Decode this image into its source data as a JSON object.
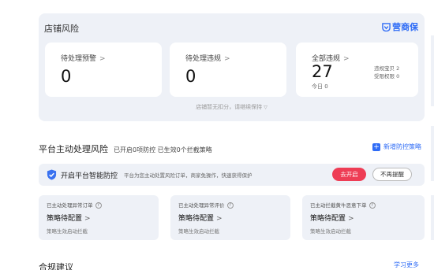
{
  "store_risk": {
    "title": "店铺风险",
    "brand": "营商保",
    "cards": [
      {
        "label": "待处理预警",
        "value": "0"
      },
      {
        "label": "待处理违规",
        "value": "0"
      },
      {
        "label": "全部违规",
        "value": "27",
        "today": "今日 0",
        "side": [
          "违规宝贝 2",
          "受限权限 0"
        ]
      }
    ],
    "note": "店铺暂无扣分，请继续保持"
  },
  "platform": {
    "title": "平台主动处理风险",
    "subtitle": "已开启0项防控 已生效0个拦截策略",
    "add_strategy": "新增防控策略",
    "smart": {
      "title": "开启平台智能防控",
      "desc": "平台为您主动处置风险订单，商家免操作，快速获得保护",
      "open_button": "去开启",
      "dismiss_button": "不再提醒"
    },
    "cards": [
      {
        "label": "已主动处理异常订单",
        "status": "策略待配置",
        "note": "策略生效启动拦截"
      },
      {
        "label": "已主动处理异常评价",
        "status": "策略待配置",
        "note": "策略生效启动拦截"
      },
      {
        "label": "已主动拦截黄牛恶意下单",
        "status": "策略待配置",
        "note": "策略生效启动拦截"
      }
    ]
  },
  "compliance": {
    "title": "合规建议",
    "learn_more": "学习更多"
  },
  "icons": {
    "chevron": "chevron-right-icon",
    "help": "help-circle-icon",
    "shield": "shield-icon",
    "plus": "plus-icon",
    "brand_logo": "brand-logo-icon"
  },
  "colors": {
    "accent": "#2f6cf6",
    "danger": "#ee3d55",
    "panel": "#eef1f7"
  }
}
